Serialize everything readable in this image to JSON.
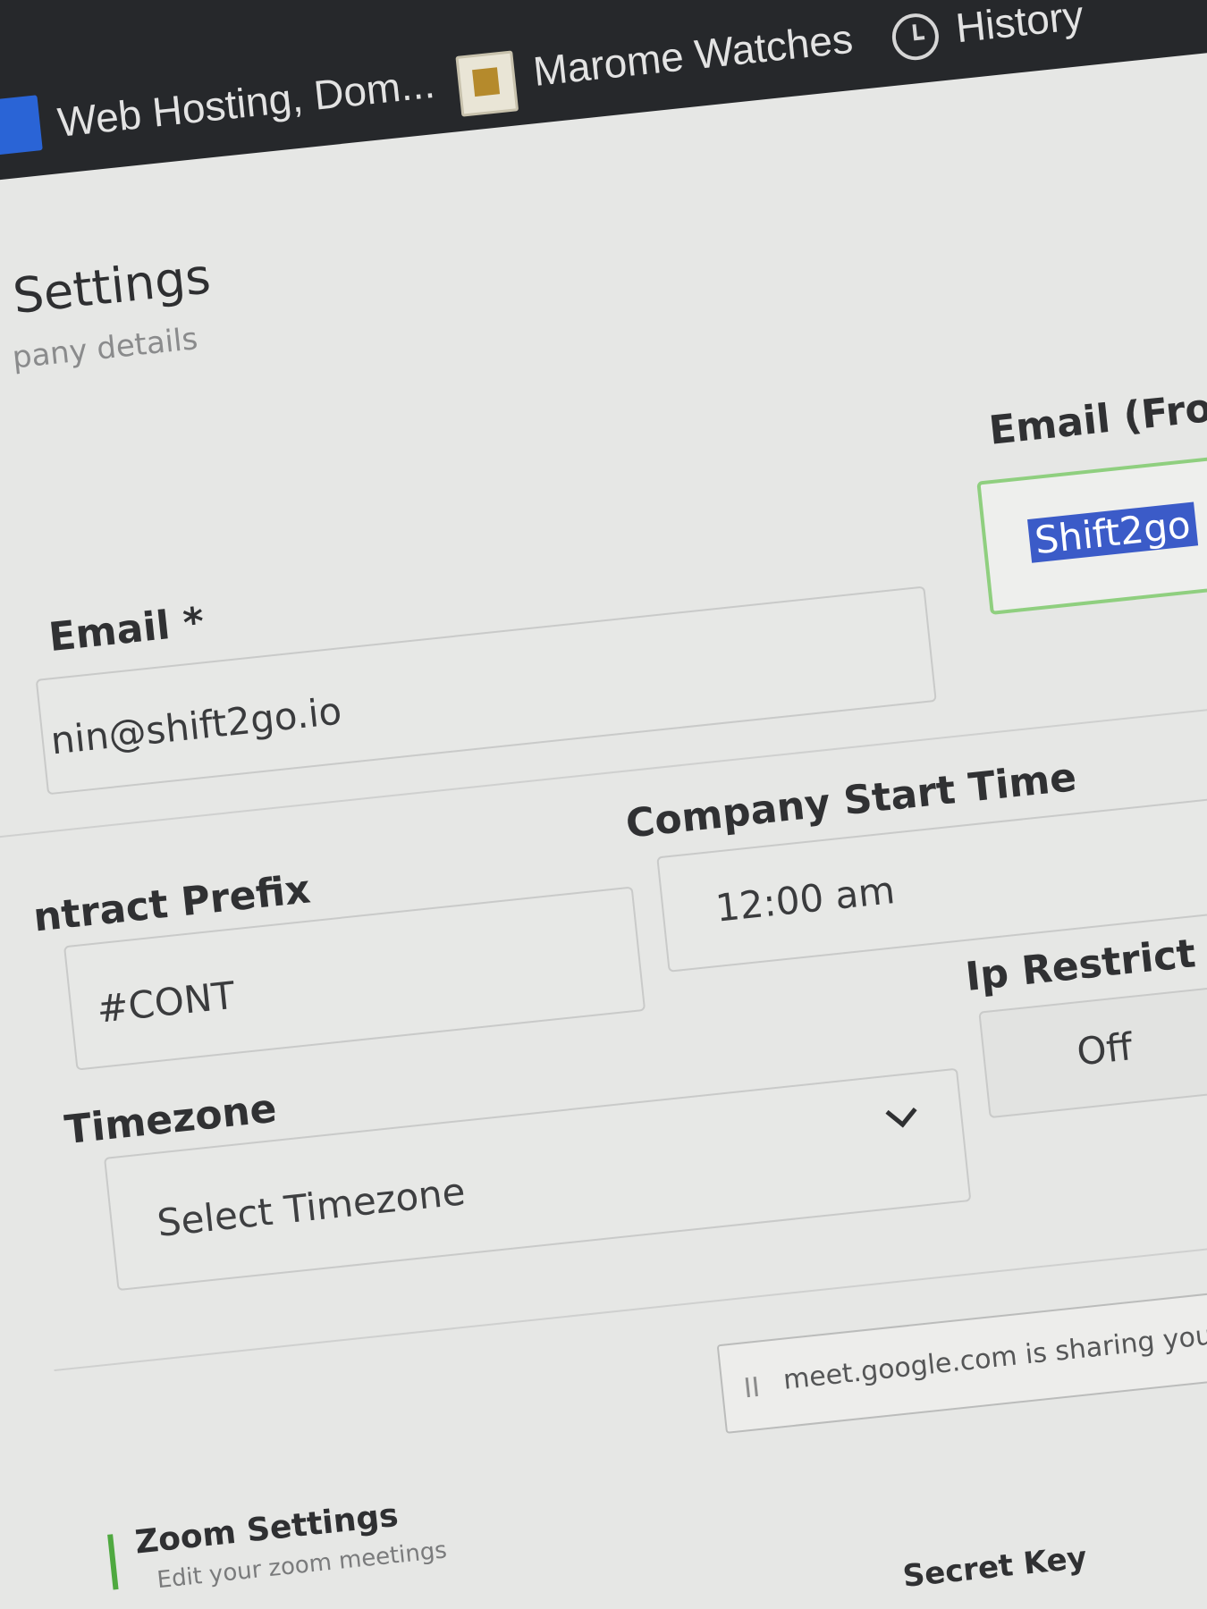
{
  "bookmarks": [
    {
      "label": "Web Hosting, Dom..."
    },
    {
      "label": "Marome Watches"
    },
    {
      "label": "History"
    }
  ],
  "page": {
    "title": "Settings",
    "subtitle": "pany details"
  },
  "form": {
    "email": {
      "label": "Email *",
      "value": "nin@shift2go.io"
    },
    "email_from": {
      "label": "Email (Fron",
      "value": "Shift2go"
    },
    "contract_prefix": {
      "label": "ntract Prefix",
      "value": "#CONT"
    },
    "company_start_time": {
      "label": "Company Start Time",
      "value": "12:00 am"
    },
    "timezone": {
      "label": "Timezone",
      "placeholder": "Select Timezone"
    },
    "ip_restrict": {
      "label": "Ip Restrict",
      "value": "Off"
    }
  },
  "share_notice": {
    "text": "meet.google.com is sharing you"
  },
  "zoom": {
    "title": "Zoom Settings",
    "subtitle": "Edit your zoom meetings",
    "secret_key_label": "Secret Key"
  },
  "colors": {
    "bookmark_bar": "#26282b",
    "selection": "#3b5bc8",
    "focus_border": "#8fcf7f",
    "accent": "#4fa940"
  }
}
